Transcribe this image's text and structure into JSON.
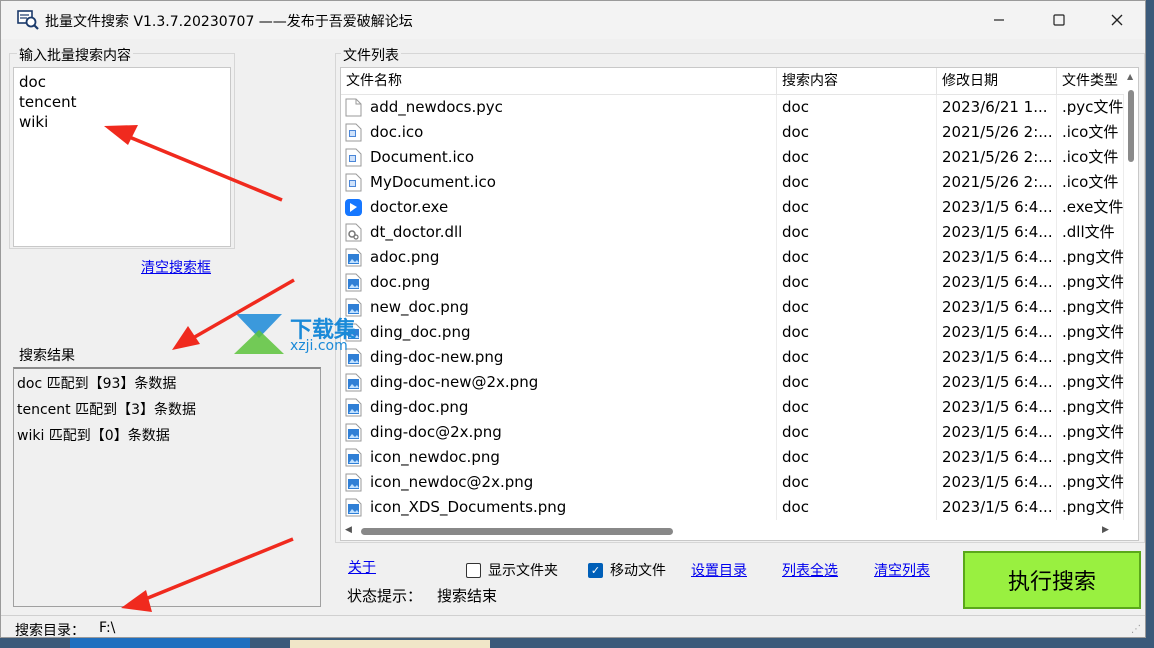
{
  "window": {
    "title": "批量文件搜索  V1.3.7.20230707  ——发布于吾爱破解论坛",
    "controls": {
      "minimize": "—",
      "maximize": "☐",
      "close": "✕"
    }
  },
  "search_panel": {
    "label": "输入批量搜索内容",
    "lines": [
      "doc",
      "tencent",
      "wiki"
    ],
    "clear_link": "清空搜索框"
  },
  "results_panel": {
    "label": "搜索结果",
    "lines": [
      "doc 匹配到【93】条数据",
      "tencent 匹配到【3】条数据",
      "wiki 匹配到【0】条数据"
    ]
  },
  "file_list": {
    "label": "文件列表",
    "columns": [
      "文件名称",
      "搜索内容",
      "修改日期",
      "文件类型"
    ],
    "rows": [
      {
        "name": "add_newdocs.pyc",
        "keyword": "doc",
        "date": "2023/6/21 1...",
        "type": ".pyc文件",
        "icon": "blank-file-icon"
      },
      {
        "name": "doc.ico",
        "keyword": "doc",
        "date": "2021/5/26 2:...",
        "type": ".ico文件",
        "icon": "ico-file-icon"
      },
      {
        "name": "Document.ico",
        "keyword": "doc",
        "date": "2021/5/26 2:...",
        "type": ".ico文件",
        "icon": "ico-file-icon"
      },
      {
        "name": "MyDocument.ico",
        "keyword": "doc",
        "date": "2021/5/26 2:...",
        "type": ".ico文件",
        "icon": "ico-file-icon"
      },
      {
        "name": "doctor.exe",
        "keyword": "doc",
        "date": "2023/1/5 6:4...",
        "type": ".exe文件",
        "icon": "exe-app-icon"
      },
      {
        "name": "dt_doctor.dll",
        "keyword": "doc",
        "date": "2023/1/5 6:4...",
        "type": ".dll文件",
        "icon": "dll-file-icon"
      },
      {
        "name": "adoc.png",
        "keyword": "doc",
        "date": "2023/1/5 6:4...",
        "type": ".png文件",
        "icon": "png-file-icon"
      },
      {
        "name": "doc.png",
        "keyword": "doc",
        "date": "2023/1/5 6:4...",
        "type": ".png文件",
        "icon": "png-file-icon"
      },
      {
        "name": "new_doc.png",
        "keyword": "doc",
        "date": "2023/1/5 6:4...",
        "type": ".png文件",
        "icon": "png-file-icon"
      },
      {
        "name": "ding_doc.png",
        "keyword": "doc",
        "date": "2023/1/5 6:4...",
        "type": ".png文件",
        "icon": "png-file-icon"
      },
      {
        "name": "ding-doc-new.png",
        "keyword": "doc",
        "date": "2023/1/5 6:4...",
        "type": ".png文件",
        "icon": "png-file-icon"
      },
      {
        "name": "ding-doc-new@2x.png",
        "keyword": "doc",
        "date": "2023/1/5 6:4...",
        "type": ".png文件",
        "icon": "png-file-icon"
      },
      {
        "name": "ding-doc.png",
        "keyword": "doc",
        "date": "2023/1/5 6:4...",
        "type": ".png文件",
        "icon": "png-file-icon"
      },
      {
        "name": "ding-doc@2x.png",
        "keyword": "doc",
        "date": "2023/1/5 6:4...",
        "type": ".png文件",
        "icon": "png-file-icon"
      },
      {
        "name": "icon_newdoc.png",
        "keyword": "doc",
        "date": "2023/1/5 6:4...",
        "type": ".png文件",
        "icon": "png-file-icon"
      },
      {
        "name": "icon_newdoc@2x.png",
        "keyword": "doc",
        "date": "2023/1/5 6:4...",
        "type": ".png文件",
        "icon": "png-file-icon"
      },
      {
        "name": "icon_XDS_Documents.png",
        "keyword": "doc",
        "date": "2023/1/5 6:4...",
        "type": ".png文件",
        "icon": "png-file-icon"
      }
    ]
  },
  "controls": {
    "about_link": "关于",
    "show_folder": {
      "label": "显示文件夹",
      "checked": false
    },
    "move_file": {
      "label": "移动文件",
      "checked": true
    },
    "set_dir_link": "设置目录",
    "select_all_link": "列表全选",
    "clear_list_link": "清空列表",
    "run_button": "执行搜索",
    "run_button_color": "#99f040"
  },
  "status": {
    "label": "状态提示：",
    "value": "搜索结束"
  },
  "statusbar": {
    "label": "搜索目录：",
    "value": "F:\\"
  },
  "watermark": {
    "brand": "下载集",
    "url": "xzji.com"
  },
  "colors": {
    "annotation_arrow": "#f02a1e",
    "link": "#0000ee",
    "checkbox_checked": "#005fb8"
  }
}
